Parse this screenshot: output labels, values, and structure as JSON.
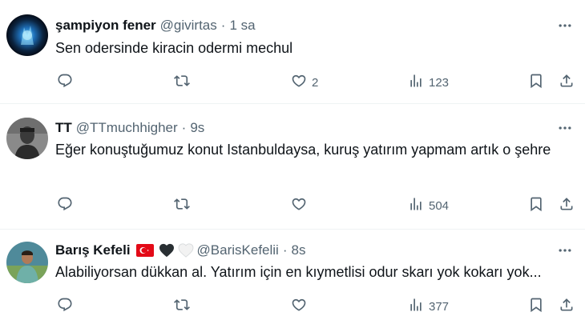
{
  "tweets": [
    {
      "name": "şampiyon fener",
      "handle": "@givirtas",
      "separator": "·",
      "time": "1 sa",
      "text": "Sen odersinde kiracin odermi mechul",
      "avatar": "dark-blue-glow-avatar",
      "stats": {
        "replies": "",
        "retweets": "",
        "likes": "2",
        "views": "123"
      }
    },
    {
      "name": "TT",
      "handle": "@TTmuchhigher",
      "separator": "·",
      "time": "9s",
      "text": "Eğer konuştuğumuz konut Istanbuldaysa, kuruş yatırım yapmam artık o şehre",
      "avatar": "grayscale-person-avatar",
      "stats": {
        "replies": "",
        "retweets": "",
        "likes": "",
        "views": "504"
      }
    },
    {
      "name": "Barış Kefeli",
      "handle": "@BarisKefelii",
      "separator": "·",
      "time": "8s",
      "text": "Alabiliyorsan dükkan al. Yatırım için en kıymetlisi odur skarı yok kokarı yok...",
      "avatar": "person-outdoor-avatar",
      "emojis": [
        "turkey-flag",
        "black-heart",
        "white-heart"
      ],
      "stats": {
        "replies": "",
        "retweets": "",
        "likes": "",
        "views": "377"
      }
    }
  ],
  "icons": {
    "reply": "reply-icon",
    "retweet": "retweet-icon",
    "like": "like-icon",
    "views": "views-icon",
    "bookmark": "bookmark-icon",
    "share": "share-icon",
    "more": "more-icon"
  },
  "colors": {
    "text_primary": "#0f1419",
    "text_secondary": "#536471",
    "divider": "#eff3f4",
    "flag_red": "#e30a17"
  }
}
